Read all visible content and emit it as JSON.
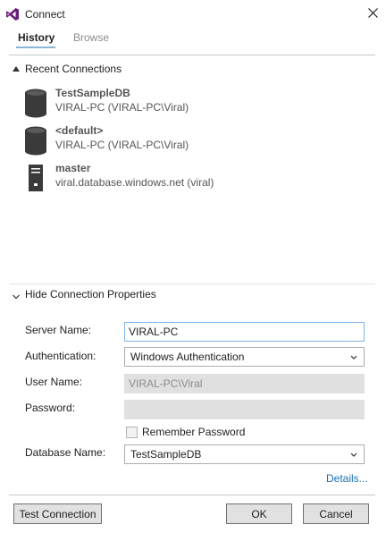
{
  "window": {
    "title": "Connect",
    "close_icon": "close-icon"
  },
  "tabs": [
    {
      "label": "History",
      "active": true
    },
    {
      "label": "Browse",
      "active": false
    }
  ],
  "recent": {
    "label": "Recent Connections",
    "items": [
      {
        "name": "TestSampleDB",
        "detail": "VIRAL-PC (VIRAL-PC\\Viral)",
        "icon": "database-icon"
      },
      {
        "name": "<default>",
        "detail": "VIRAL-PC (VIRAL-PC\\Viral)",
        "icon": "database-icon"
      },
      {
        "name": "master",
        "detail": "viral.database.windows.net (viral)",
        "icon": "server-icon"
      }
    ]
  },
  "properties": {
    "toggle_label": "Hide Connection Properties",
    "server_name": {
      "label": "Server Name:",
      "value": "VIRAL-PC"
    },
    "authentication": {
      "label": "Authentication:",
      "value": "Windows Authentication"
    },
    "user_name": {
      "label": "User Name:",
      "value": "VIRAL-PC\\Viral"
    },
    "password": {
      "label": "Password:",
      "value": ""
    },
    "remember_password": {
      "label": "Remember Password",
      "checked": false
    },
    "database_name": {
      "label": "Database Name:",
      "value": "TestSampleDB"
    },
    "details_link": "Details..."
  },
  "buttons": {
    "test_connection": "Test Connection",
    "ok": "OK",
    "cancel": "Cancel"
  },
  "colors": {
    "accent": "#68217a",
    "link": "#1a6fb5",
    "input_focus_border": "#7eb4ea"
  }
}
